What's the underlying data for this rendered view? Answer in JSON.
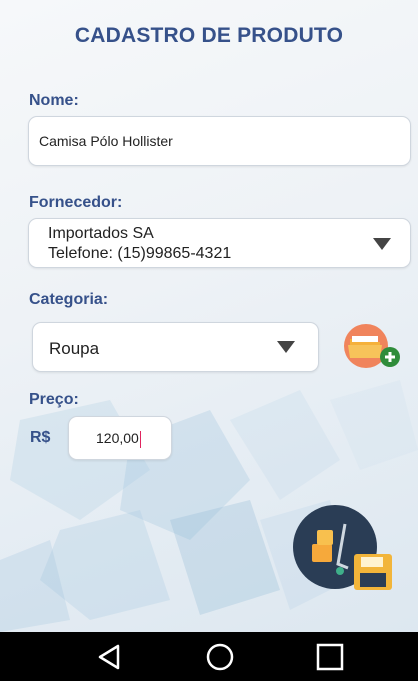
{
  "header": {
    "title": "CADASTRO DE PRODUTO"
  },
  "form": {
    "nome": {
      "label": "Nome:",
      "value": "Camisa Pólo Hollister"
    },
    "fornecedor": {
      "label": "Fornecedor:",
      "line1": "Importados SA",
      "line2": "Telefone: (15)99865-4321"
    },
    "categoria": {
      "label": "Categoria:",
      "value": "Roupa"
    },
    "preco": {
      "label": "Preço:",
      "currency": "R$",
      "value": "120,00"
    }
  },
  "icons": {
    "add_category": "folder-add-icon",
    "save": "save-product-icon",
    "dropdown": "dropdown-arrow-icon"
  },
  "colors": {
    "label": "#36518a",
    "accent_cursor": "#e0245e",
    "folder_circle": "#f0845c",
    "save_circle": "#2a3d55"
  },
  "navbar": {
    "back": "back-icon",
    "home": "home-icon",
    "recents": "recents-icon"
  }
}
